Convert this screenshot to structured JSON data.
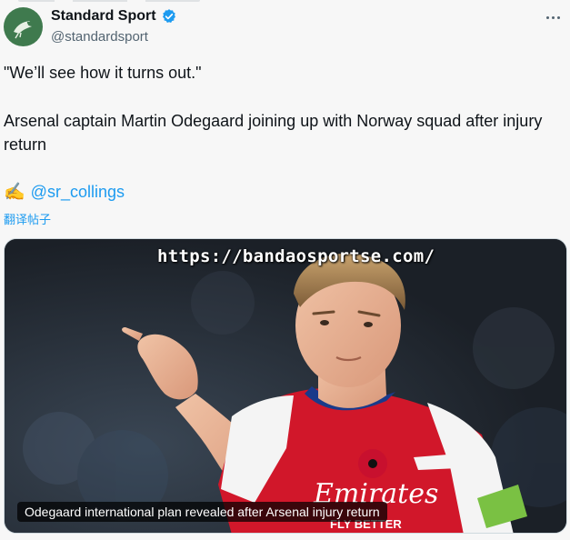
{
  "account": {
    "display_name": "Standard Sport",
    "handle": "@standardsport",
    "verified_color": "#1d9bf0",
    "avatar_icon": "bird-logo-icon"
  },
  "tweet": {
    "quote": "\"We’ll see how it turns out.\"",
    "headline": "Arsenal captain Martin Odegaard joining up with Norway squad after injury return",
    "writing_icon": "✍️",
    "mention": "@sr_collings",
    "translate_label": "翻译帖子"
  },
  "media": {
    "watermark": "https://bandaosportse.com/",
    "caption": "Odegaard international plan revealed after Arsenal injury return",
    "jersey_sponsor": "Emirates",
    "jersey_subtext": "FLY BETTER"
  },
  "colors": {
    "link": "#1d9bf0",
    "secondary_text": "#536471",
    "arsenal_red": "#d1172a"
  }
}
